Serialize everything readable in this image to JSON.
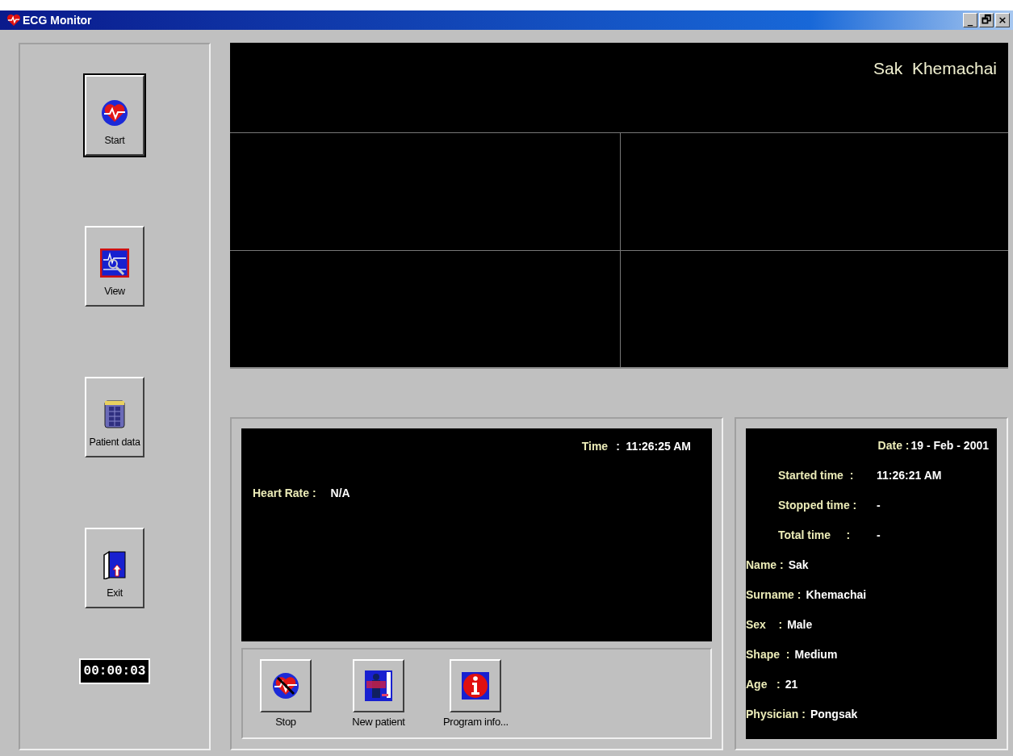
{
  "window": {
    "title": "ECG Monitor",
    "controls": [
      "_",
      "🗗",
      "×"
    ]
  },
  "sidebar": {
    "buttons": [
      {
        "label": "Start",
        "selected": true
      },
      {
        "label": "View",
        "selected": false
      },
      {
        "label": "Patient data",
        "selected": false
      },
      {
        "label": "Exit",
        "selected": false
      }
    ],
    "timer": "00:00:03"
  },
  "monitor": {
    "patient_name": "Sak  Khemachai"
  },
  "readout": {
    "time_label": "Time",
    "time_value": ":  11:26:25 AM",
    "heart_rate_label": "Heart Rate :",
    "heart_rate_value": "N/A"
  },
  "toolbar": [
    {
      "label": "Stop"
    },
    {
      "label": "New patient"
    },
    {
      "label": "Program info..."
    }
  ],
  "info": [
    {
      "kind": "date",
      "label": "Date :",
      "value": "19 - Feb - 2001"
    },
    {
      "kind": "time",
      "label": "Started time  :",
      "value": "11:26:21 AM"
    },
    {
      "kind": "time",
      "label": "Stopped time :",
      "value": "-"
    },
    {
      "kind": "time",
      "label": "Total time     :",
      "value": "-"
    },
    {
      "kind": "patient",
      "label": "Name :",
      "value": "Sak"
    },
    {
      "kind": "patient",
      "label": "Surname :",
      "value": "Khemachai"
    },
    {
      "kind": "patient",
      "label": "Sex    :",
      "value": "Male"
    },
    {
      "kind": "patient",
      "label": "Shape  :",
      "value": "Medium"
    },
    {
      "kind": "patient",
      "label": "Age   :",
      "value": "21"
    },
    {
      "kind": "patient",
      "label": "Physician :",
      "value": "Pongsak"
    }
  ]
}
